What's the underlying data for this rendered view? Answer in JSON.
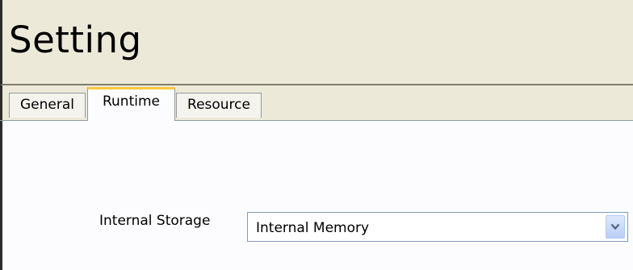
{
  "header": {
    "title": "Setting"
  },
  "tabs": [
    {
      "label": "General",
      "active": false
    },
    {
      "label": "Runtime",
      "active": true
    },
    {
      "label": "Resource",
      "active": false
    }
  ],
  "runtime": {
    "internal_storage_label": "Internal Storage",
    "internal_storage_value": "Internal Memory"
  },
  "colors": {
    "header_bg": "#ece9d8",
    "active_tab_accent": "#ffc83c",
    "panel_bg": "#fcfcfe"
  },
  "icons": {
    "dropdown": "chevron-down-icon"
  }
}
